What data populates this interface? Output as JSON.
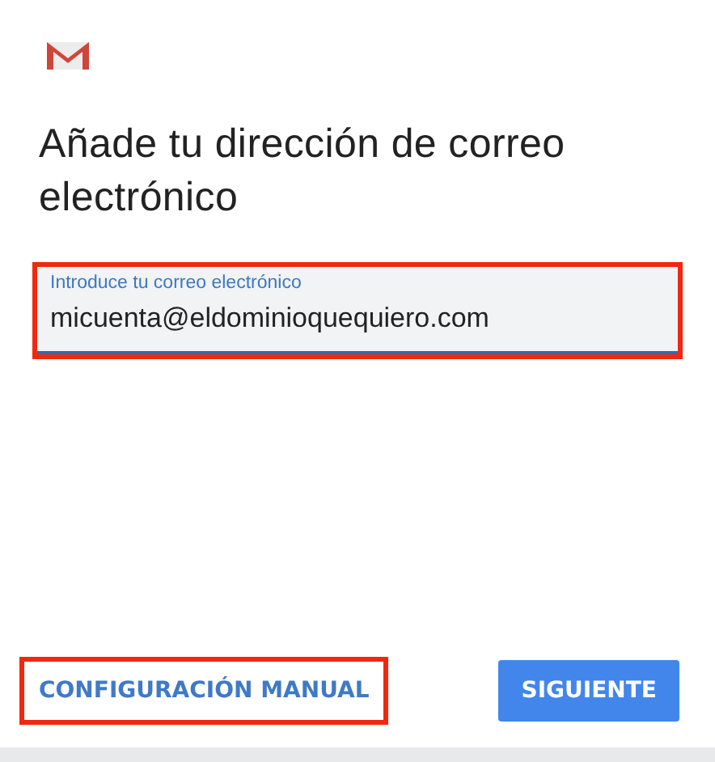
{
  "title": "Añade tu dirección de correo electrónico",
  "email_field": {
    "label": "Introduce tu correo electrónico",
    "value": "micuenta@eldominioquequiero.com",
    "focused": true,
    "highlighted": true
  },
  "buttons": [
    {
      "label": "CONFIGURACIÓN MANUAL",
      "kind": "text",
      "highlighted": true
    },
    {
      "label": "SIGUIENTE",
      "kind": "primary",
      "highlighted": false
    }
  ]
}
